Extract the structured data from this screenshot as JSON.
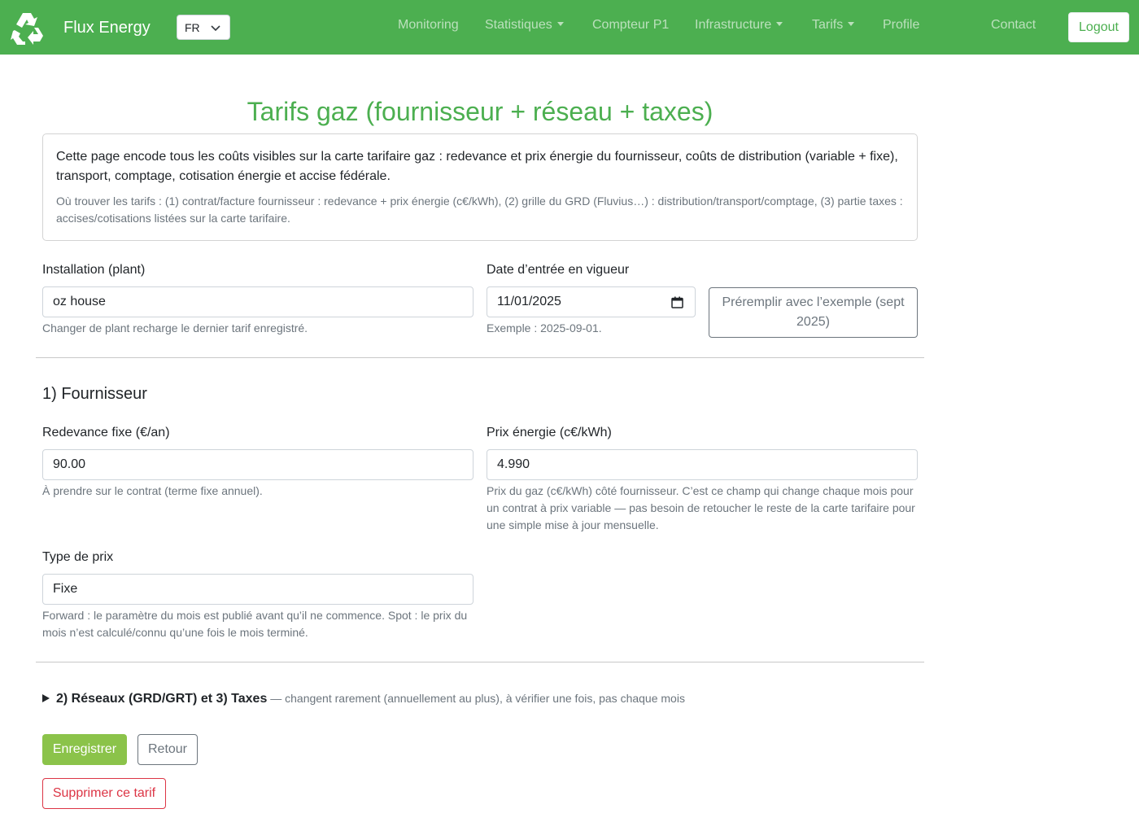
{
  "navbar": {
    "brand_name": "Flux Energy",
    "lang": "FR",
    "links": {
      "monitoring": "Monitoring",
      "statistiques": "Statistiques",
      "compteur": "Compteur P1",
      "infrastructure": "Infrastructure",
      "tarifs": "Tarifs",
      "profile": "Profile",
      "contact": "Contact"
    },
    "icon_glyph": "",
    "logout": "Logout"
  },
  "page": {
    "title": "Tarifs gaz (fournisseur + réseau + taxes)"
  },
  "info": {
    "main": "Cette page encode tous les coûts visibles sur la carte tarifaire gaz : redevance et prix énergie du fournisseur, coûts de distribution (variable + fixe), transport, comptage, cotisation énergie et accise fédérale.",
    "sub": "Où trouver les tarifs : (1) contrat/facture fournisseur : redevance + prix énergie (c€/kWh), (2) grille du GRD (Fluvius…) : distribution/transport/comptage, (3) partie taxes : accises/cotisations listées sur la carte tarifaire."
  },
  "form": {
    "plant": {
      "label": "Installation (plant)",
      "value": "oz house",
      "help": "Changer de plant recharge le dernier tarif enregistré."
    },
    "date": {
      "label": "Date d’entrée en vigueur",
      "value": "11/01/2025",
      "help": "Exemple : 2025-09-01."
    },
    "prefill_button": "Préremplir avec l’exemple (sept 2025)"
  },
  "supplier": {
    "section_title": "1) Fournisseur",
    "redevance": {
      "label": "Redevance fixe (€/an)",
      "value": "90.00",
      "help": "À prendre sur le contrat (terme fixe annuel)."
    },
    "prix": {
      "label": "Prix énergie (c€/kWh)",
      "value": "4.990",
      "help": "Prix du gaz (c€/kWh) côté fournisseur. C’est ce champ qui change chaque mois pour un contrat à prix variable — pas besoin de retoucher le reste de la carte tarifaire pour une simple mise à jour mensuelle."
    },
    "type": {
      "label": "Type de prix",
      "value": "Fixe",
      "help": "Forward : le paramètre du mois est publié avant qu’il ne commence. Spot : le prix du mois n’est calculé/connu qu’une fois le mois terminé."
    }
  },
  "details": {
    "summary_strong": "2) Réseaux (GRD/GRT) et 3) Taxes",
    "summary_note": " — changent rarement (annuellement au plus), à vérifier une fois, pas chaque mois"
  },
  "actions": {
    "save": "Enregistrer",
    "back": "Retour",
    "delete": "Supprimer ce tarif"
  },
  "colors": {
    "brand": "#4caf50",
    "save_button": "#8bc34a",
    "danger": "#dc3545",
    "muted": "#6c757d"
  }
}
